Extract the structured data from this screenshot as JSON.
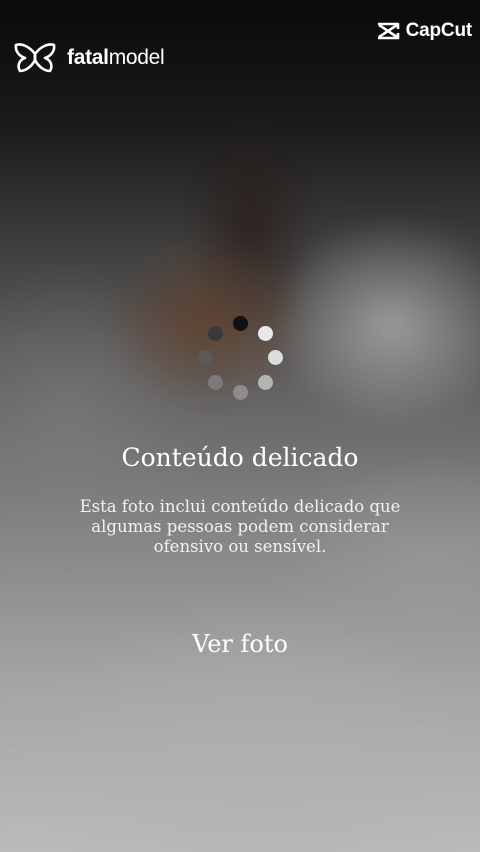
{
  "brand": {
    "name_bold": "fatal",
    "name_regular": "model",
    "icon": "butterfly-logo-icon"
  },
  "watermark": {
    "name": "CapCut",
    "icon": "capcut-logo-icon"
  },
  "spinner": {
    "icon": "loading-spinner-icon"
  },
  "notice": {
    "title": "Conteúdo delicado",
    "body": "Esta foto inclui conteúdo delicado que algumas pessoas podem considerar ofensivo ou sensível.",
    "view_button_label": "Ver foto"
  },
  "colors": {
    "text": "#ffffff",
    "spinner_dark": "#111111",
    "spinner_light": "#e6e6e6"
  }
}
